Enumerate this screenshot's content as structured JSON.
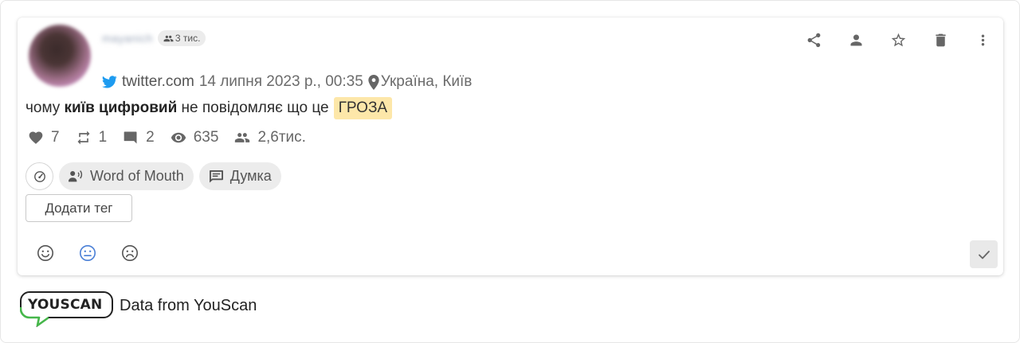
{
  "author": {
    "name": "mayanich",
    "followers_badge": "3 тис.",
    "source": "twitter.com",
    "date": "14 липня 2023 р., 00:35",
    "location": "Україна, Київ"
  },
  "post": {
    "text_before": "чому ",
    "text_bold": "київ цифровий",
    "text_after": " не повідомляє що це",
    "highlight": "ГРОЗА"
  },
  "metrics": {
    "likes": "7",
    "retweets": "1",
    "comments": "2",
    "views": "635",
    "audience": "2,6тис."
  },
  "tags": {
    "chip1": "Word of Mouth",
    "chip2": "Думка",
    "add_tag_label": "Додати тег"
  },
  "footer": {
    "logo_text": "YOUSCAN",
    "caption": "Data from YouScan"
  },
  "colors": {
    "highlight_bg": "#fde7a9",
    "twitter_blue": "#1d9bf0",
    "neutral_selected": "#4a7fd6",
    "logo_green": "#46b74b"
  },
  "icons": [
    "share-icon",
    "person-icon",
    "star-icon",
    "trash-icon",
    "more-vert-icon",
    "heart-icon",
    "retweet-icon",
    "comment-icon",
    "eye-icon",
    "people-icon"
  ]
}
